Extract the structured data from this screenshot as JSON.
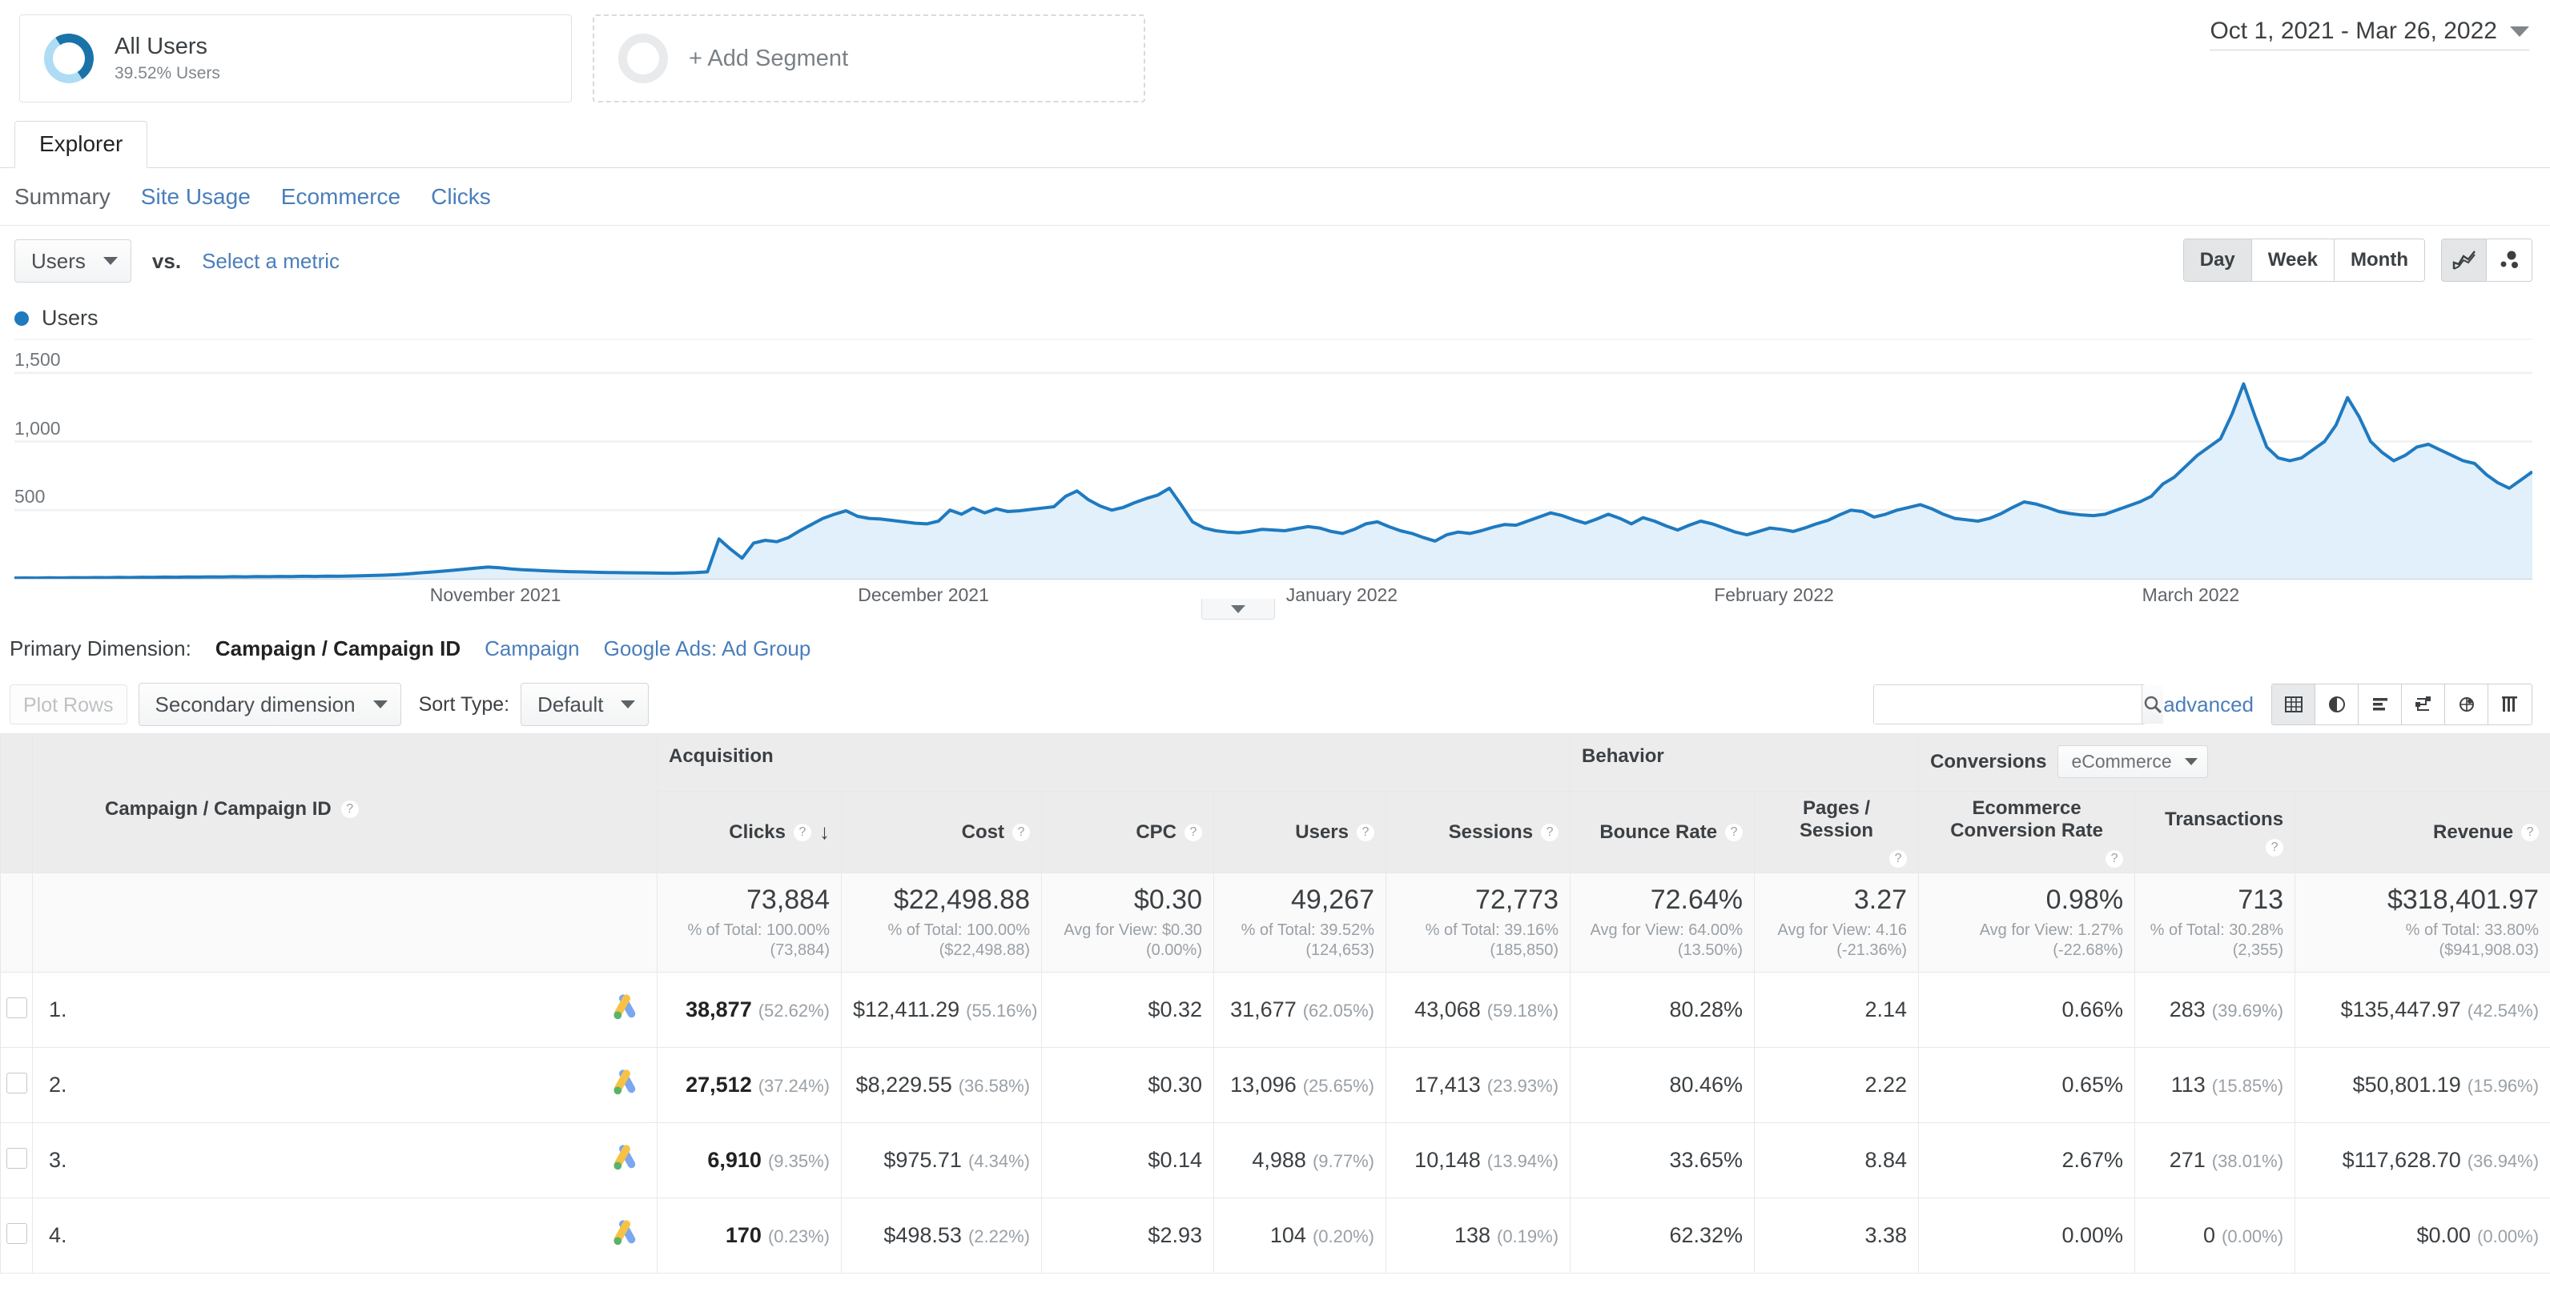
{
  "segments": [
    {
      "title": "All Users",
      "sub": "39.52% Users",
      "type": "filled"
    },
    {
      "title": "+ Add Segment",
      "sub": "",
      "type": "add"
    }
  ],
  "date_range": "Oct 1, 2021 - Mar 26, 2022",
  "tabs": [
    {
      "label": "Explorer",
      "active": true
    }
  ],
  "subnav": [
    {
      "label": "Summary",
      "active": true
    },
    {
      "label": "Site Usage",
      "active": false
    },
    {
      "label": "Ecommerce",
      "active": false
    },
    {
      "label": "Clicks",
      "active": false
    }
  ],
  "metric_toolbar": {
    "metric": "Users",
    "vs": "vs.",
    "select_metric": "Select a metric",
    "granularity": [
      "Day",
      "Week",
      "Month"
    ],
    "granularity_active": "Day",
    "chart_type_icons": [
      "line-chart-icon",
      "scatter-plot-icon"
    ],
    "chart_type_active": "line-chart-icon"
  },
  "chart_data": {
    "type": "area",
    "title": "",
    "series_name": "Users",
    "ylabel": "",
    "xlabel": "",
    "ylim": [
      0,
      1750
    ],
    "yticks": [
      500,
      1000,
      1500
    ],
    "ytick_labels": [
      "500",
      "1,000",
      "1,500"
    ],
    "xtick_labels": [
      "November 2021",
      "December 2021",
      "January 2022",
      "February 2022",
      "March 2022"
    ],
    "xtick_positions": [
      0.165,
      0.335,
      0.505,
      0.675,
      0.845
    ],
    "grid": true,
    "legend": "Users",
    "line_color": "#1f7ac0",
    "fill_color": "#e1f0fa",
    "values": [
      5,
      6,
      5,
      7,
      6,
      8,
      7,
      9,
      8,
      10,
      9,
      11,
      10,
      12,
      11,
      13,
      12,
      14,
      13,
      15,
      14,
      16,
      15,
      17,
      16,
      18,
      17,
      19,
      18,
      20,
      22,
      24,
      26,
      30,
      35,
      42,
      48,
      55,
      62,
      70,
      78,
      85,
      80,
      72,
      66,
      62,
      58,
      55,
      52,
      50,
      48,
      46,
      45,
      44,
      43,
      42,
      41,
      40,
      42,
      45,
      50,
      290,
      215,
      150,
      260,
      280,
      270,
      300,
      350,
      395,
      440,
      470,
      495,
      455,
      440,
      435,
      425,
      415,
      405,
      400,
      420,
      500,
      470,
      515,
      480,
      510,
      490,
      495,
      505,
      515,
      525,
      600,
      640,
      575,
      530,
      500,
      520,
      555,
      585,
      610,
      660,
      540,
      415,
      370,
      350,
      340,
      335,
      345,
      360,
      355,
      350,
      365,
      380,
      370,
      345,
      330,
      360,
      400,
      415,
      380,
      350,
      330,
      300,
      275,
      320,
      340,
      330,
      350,
      375,
      395,
      390,
      420,
      450,
      480,
      460,
      430,
      405,
      435,
      470,
      440,
      400,
      445,
      420,
      385,
      355,
      390,
      420,
      400,
      370,
      340,
      320,
      345,
      370,
      360,
      345,
      370,
      400,
      425,
      465,
      500,
      490,
      450,
      470,
      500,
      520,
      540,
      510,
      470,
      440,
      430,
      420,
      440,
      475,
      520,
      560,
      545,
      520,
      490,
      475,
      465,
      460,
      470,
      500,
      530,
      560,
      600,
      690,
      740,
      820,
      900,
      960,
      1020,
      1200,
      1420,
      1180,
      960,
      880,
      860,
      880,
      940,
      1000,
      1120,
      1320,
      1180,
      1000,
      920,
      860,
      900,
      960,
      980,
      940,
      900,
      860,
      840,
      760,
      700,
      660,
      720,
      780
    ]
  },
  "primary_dimension": {
    "label": "Primary Dimension:",
    "options": [
      {
        "label": "Campaign / Campaign ID",
        "selected": true
      },
      {
        "label": "Campaign",
        "selected": false
      },
      {
        "label": "Google Ads: Ad Group",
        "selected": false
      }
    ]
  },
  "table_toolbar": {
    "plot_rows": "Plot Rows",
    "secondary_dimension": "Secondary dimension",
    "sort_type_label": "Sort Type:",
    "sort_type_value": "Default",
    "search_value": "",
    "search_placeholder": "",
    "advanced": "advanced",
    "view_icons": [
      "table-view-icon",
      "pie-chart-view-icon",
      "bar-chart-view-icon",
      "comparison-view-icon",
      "pivot-view-icon",
      "term-cloud-view-icon"
    ],
    "view_active": "table-view-icon"
  },
  "table": {
    "dimension_header": "Campaign / Campaign ID",
    "group_headers": [
      {
        "label": "Acquisition",
        "span": 5
      },
      {
        "label": "Behavior",
        "span": 2
      },
      {
        "label": "Conversions",
        "span": 3,
        "selector": "eCommerce"
      }
    ],
    "columns": [
      {
        "label": "Clicks",
        "sorted": true,
        "sort_dir": "desc"
      },
      {
        "label": "Cost"
      },
      {
        "label": "CPC"
      },
      {
        "label": "Users"
      },
      {
        "label": "Sessions"
      },
      {
        "label": "Bounce Rate"
      },
      {
        "label": "Pages / Session"
      },
      {
        "label": "Ecommerce Conversion Rate"
      },
      {
        "label": "Transactions"
      },
      {
        "label": "Revenue"
      }
    ],
    "totals": [
      {
        "big": "73,884",
        "sub": "% of Total: 100.00% (73,884)"
      },
      {
        "big": "$22,498.88",
        "sub": "% of Total: 100.00% ($22,498.88)"
      },
      {
        "big": "$0.30",
        "sub": "Avg for View: $0.30 (0.00%)"
      },
      {
        "big": "49,267",
        "sub": "% of Total: 39.52% (124,653)"
      },
      {
        "big": "72,773",
        "sub": "% of Total: 39.16% (185,850)"
      },
      {
        "big": "72.64%",
        "sub": "Avg for View: 64.00% (13.50%)"
      },
      {
        "big": "3.27",
        "sub": "Avg for View: 4.16 (-21.36%)"
      },
      {
        "big": "0.98%",
        "sub": "Avg for View: 1.27% (-22.68%)"
      },
      {
        "big": "713",
        "sub": "% of Total: 30.28% (2,355)"
      },
      {
        "big": "$318,401.97",
        "sub": "% of Total: 33.80% ($941,908.03)"
      }
    ],
    "rows": [
      {
        "index": "1.",
        "icon": "google-ads-icon",
        "cells": [
          {
            "v": "38,877",
            "pct": "(52.62%)",
            "bold": true
          },
          {
            "v": "$12,411.29",
            "pct": "(55.16%)"
          },
          {
            "v": "$0.32",
            "pct": ""
          },
          {
            "v": "31,677",
            "pct": "(62.05%)"
          },
          {
            "v": "43,068",
            "pct": "(59.18%)"
          },
          {
            "v": "80.28%",
            "pct": ""
          },
          {
            "v": "2.14",
            "pct": ""
          },
          {
            "v": "0.66%",
            "pct": ""
          },
          {
            "v": "283",
            "pct": "(39.69%)"
          },
          {
            "v": "$135,447.97",
            "pct": "(42.54%)"
          }
        ]
      },
      {
        "index": "2.",
        "icon": "google-ads-icon",
        "cells": [
          {
            "v": "27,512",
            "pct": "(37.24%)",
            "bold": true
          },
          {
            "v": "$8,229.55",
            "pct": "(36.58%)"
          },
          {
            "v": "$0.30",
            "pct": ""
          },
          {
            "v": "13,096",
            "pct": "(25.65%)"
          },
          {
            "v": "17,413",
            "pct": "(23.93%)"
          },
          {
            "v": "80.46%",
            "pct": ""
          },
          {
            "v": "2.22",
            "pct": ""
          },
          {
            "v": "0.65%",
            "pct": ""
          },
          {
            "v": "113",
            "pct": "(15.85%)"
          },
          {
            "v": "$50,801.19",
            "pct": "(15.96%)"
          }
        ]
      },
      {
        "index": "3.",
        "icon": "google-ads-icon",
        "cells": [
          {
            "v": "6,910",
            "pct": "(9.35%)",
            "bold": true
          },
          {
            "v": "$975.71",
            "pct": "(4.34%)"
          },
          {
            "v": "$0.14",
            "pct": ""
          },
          {
            "v": "4,988",
            "pct": "(9.77%)"
          },
          {
            "v": "10,148",
            "pct": "(13.94%)"
          },
          {
            "v": "33.65%",
            "pct": ""
          },
          {
            "v": "8.84",
            "pct": ""
          },
          {
            "v": "2.67%",
            "pct": ""
          },
          {
            "v": "271",
            "pct": "(38.01%)"
          },
          {
            "v": "$117,628.70",
            "pct": "(36.94%)"
          }
        ]
      },
      {
        "index": "4.",
        "icon": "google-ads-icon",
        "cells": [
          {
            "v": "170",
            "pct": "(0.23%)",
            "bold": true
          },
          {
            "v": "$498.53",
            "pct": "(2.22%)"
          },
          {
            "v": "$2.93",
            "pct": ""
          },
          {
            "v": "104",
            "pct": "(0.20%)"
          },
          {
            "v": "138",
            "pct": "(0.19%)"
          },
          {
            "v": "62.32%",
            "pct": ""
          },
          {
            "v": "3.38",
            "pct": ""
          },
          {
            "v": "0.00%",
            "pct": ""
          },
          {
            "v": "0",
            "pct": "(0.00%)"
          },
          {
            "v": "$0.00",
            "pct": "(0.00%)"
          }
        ]
      }
    ]
  },
  "colors": {
    "accent": "#1f7ac0",
    "link": "#4a7ebb",
    "header_bg": "#ececed",
    "chart_fill": "#e1f0fa"
  }
}
